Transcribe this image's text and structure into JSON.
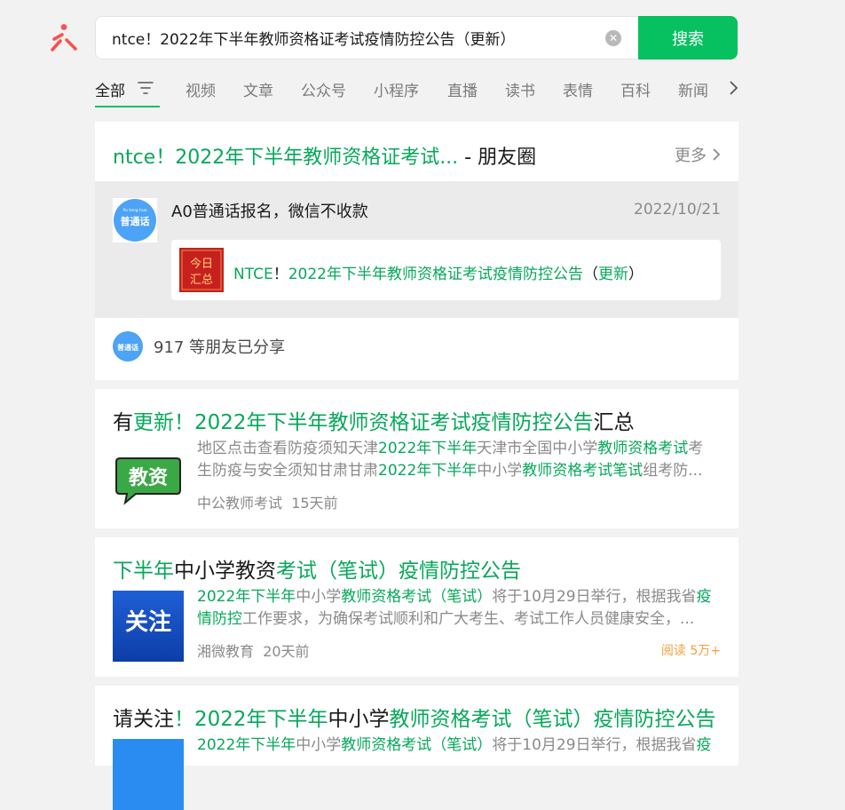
{
  "search": {
    "query": "ntce！2022年下半年教师资格证考试疫情防控公告（更新）",
    "button_label": "搜索",
    "clear_glyph": "✕"
  },
  "tabs": [
    {
      "label": "全部",
      "active": true
    },
    {
      "label": "视频"
    },
    {
      "label": "文章"
    },
    {
      "label": "公众号"
    },
    {
      "label": "小程序"
    },
    {
      "label": "直播"
    },
    {
      "label": "读书"
    },
    {
      "label": "表情"
    },
    {
      "label": "百科"
    },
    {
      "label": "新闻"
    }
  ],
  "moments": {
    "title_hl": "ntce！2022年下半年教师资格证考试...",
    "title_suffix": " - 朋友圈",
    "more_label": "更多",
    "post": {
      "author_text": "A0普通话报名，微信不收款",
      "date": "2022/10/21",
      "avatar_text": "普通话",
      "avatar_pinyin": "Pu tong hua",
      "thumb_text_1": "今日",
      "thumb_text_2": "汇总",
      "link_parts": [
        "NTCE",
        "！",
        "2022年下半年教师资格证考试疫情防控公告",
        "（",
        "更新",
        "）"
      ]
    },
    "share_count": "917",
    "share_text": "等朋友已分享"
  },
  "results": [
    {
      "title_parts": [
        "有",
        "更新！2022年下半年教师资格证考试疫情防控公告",
        "汇总"
      ],
      "thumb_text": "教资",
      "snippet_line1": [
        "地区点击查看防疫须知天津",
        "2022年下半年",
        "天津市全国中小学",
        "教师资格考试",
        "考"
      ],
      "snippet_line2": [
        "生防疫与安全须知甘肃甘肃",
        "2022年下半年",
        "中小学",
        "教师资格考试笔试",
        "组考防..."
      ],
      "source": "中公教师考试",
      "age": "15天前"
    },
    {
      "title_parts": [
        "下半年",
        "中小学教资",
        "考试（笔试）疫情防控公告"
      ],
      "thumb_text": "关注",
      "snippet_line1": [
        "2022年下半年",
        "中小学",
        "教师资格考试（笔试）",
        "将于10月29日举行，根据我省",
        "疫"
      ],
      "snippet_line2": [
        "情防控",
        "工作要求，为确保考试顺利和广大考生、考试工作人员健康安全，..."
      ],
      "source": "湘微教育",
      "age": "20天前",
      "reads": "阅读 5万+"
    },
    {
      "title_parts": [
        "请关注",
        "！2022年下半年",
        "中小学",
        "教师资格考试（笔试）疫情防控公告"
      ],
      "snippet_line1": [
        "2022年下半年",
        "中小学",
        "教师资格考试（笔试）",
        "将于10月29日举行，根据我省",
        "疫"
      ]
    }
  ]
}
